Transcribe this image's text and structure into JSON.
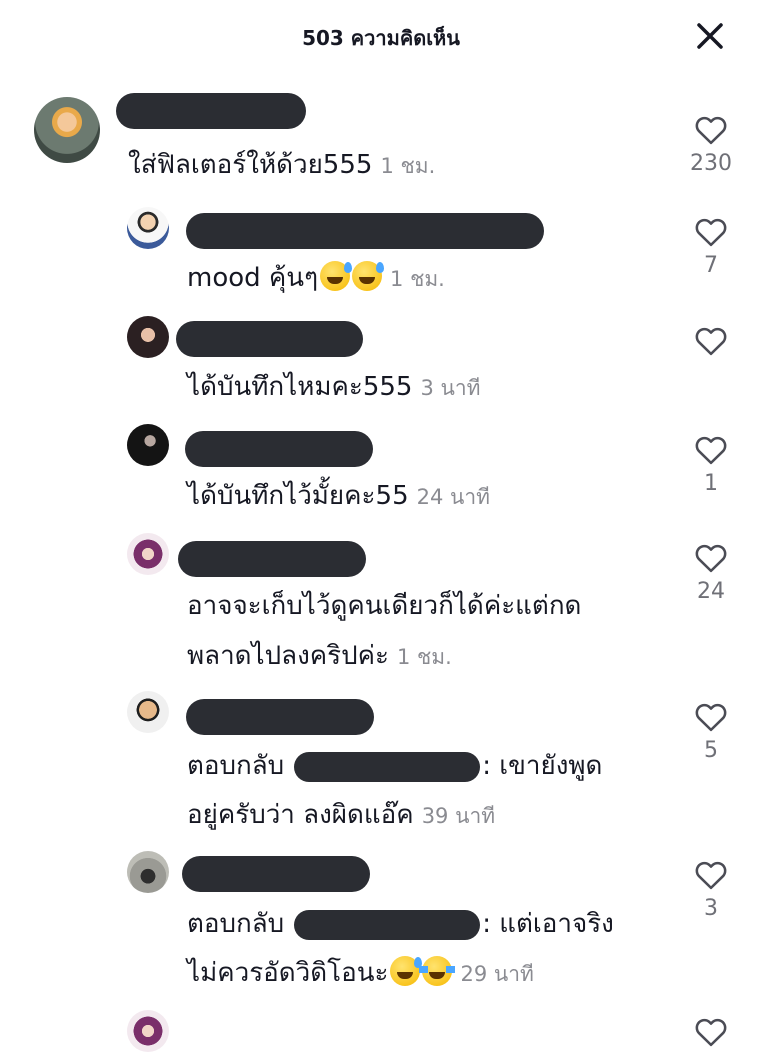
{
  "header": {
    "title": "503 ความคิดเห็น"
  },
  "icons": {
    "close": "close-icon",
    "like": "heart-outline-icon",
    "emoji_sweat": "grinning-sweat-emoji",
    "emoji_tears": "tears-of-joy-emoji"
  },
  "comments": [
    {
      "text": "ใส่ฟิลเตอร์ให้ด้วย555",
      "time": "1 ชม.",
      "likes": "230"
    },
    {
      "text": "mood คุ้นๆ",
      "time": "1 ชม.",
      "likes": "7"
    },
    {
      "text": "ได้บันทึกไหมคะ555",
      "time": "3 นาที",
      "likes": ""
    },
    {
      "text": "ได้บันทึกไว้มั้ยคะ55",
      "time": "24 นาที",
      "likes": "1"
    },
    {
      "text_line1": "อาจจะเก็บไว้ดูคนเดียวก็ได้ค่ะแต่กด",
      "text_line2": "พลาดไปลงคริปค่ะ",
      "time": "1 ชม.",
      "likes": "24"
    },
    {
      "reply_prefix": "ตอบกลับ",
      "reply_suffix": ": เขายังพูด",
      "text_line2": "อยู่ครับว่า ลงผิดแอ๊ค",
      "time": "39 นาที",
      "likes": "5"
    },
    {
      "reply_prefix": "ตอบกลับ",
      "reply_suffix": ": แต่เอาจริง",
      "text_line2": "ไม่ควรอัดวิดิโอนะ",
      "time": "29 นาที",
      "likes": "3"
    }
  ]
}
